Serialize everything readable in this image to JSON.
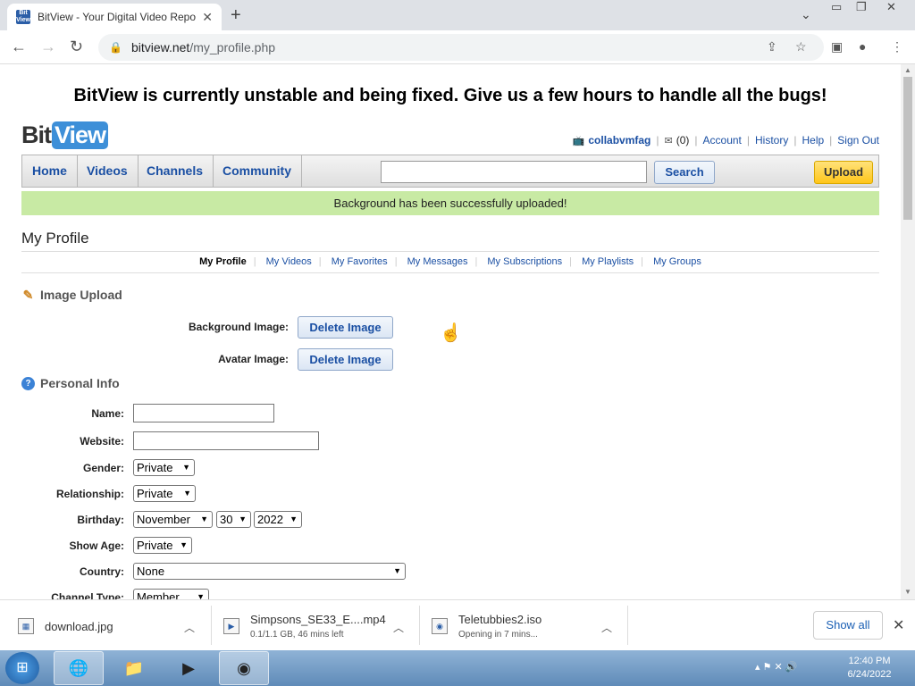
{
  "browser": {
    "tab_title": "BitView - Your Digital Video Repo",
    "favicon_text": "Bit View",
    "url_host": "bitview.net",
    "url_path": "/my_profile.php"
  },
  "site": {
    "banner": "BitView is currently unstable and being fixed. Give us a few hours to handle all the bugs!",
    "logo_bit": "Bit",
    "logo_view": "View",
    "user": {
      "username": "collabvmfag",
      "messages_count": "(0)",
      "links": [
        "Account",
        "History",
        "Help",
        "Sign Out"
      ]
    },
    "nav": [
      "Home",
      "Videos",
      "Channels",
      "Community"
    ],
    "search_button": "Search",
    "upload_button": "Upload",
    "notice": "Background has been successfully uploaded!"
  },
  "profile": {
    "title": "My Profile",
    "subnav": [
      "My Profile",
      "My Videos",
      "My Favorites",
      "My Messages",
      "My Subscriptions",
      "My Playlists",
      "My Groups"
    ],
    "image_upload": {
      "heading": "Image Upload",
      "background_label": "Background Image:",
      "avatar_label": "Avatar Image:",
      "delete_label": "Delete Image"
    },
    "personal_info": {
      "heading": "Personal Info",
      "name_label": "Name:",
      "website_label": "Website:",
      "gender_label": "Gender:",
      "gender_value": "Private",
      "relationship_label": "Relationship:",
      "relationship_value": "Private",
      "birthday_label": "Birthday:",
      "birthday_month": "November",
      "birthday_day": "30",
      "birthday_year": "2022",
      "show_age_label": "Show Age:",
      "show_age_value": "Private",
      "country_label": "Country:",
      "country_value": "None",
      "channel_type_label": "Channel Type:",
      "channel_type_value": "Member"
    }
  },
  "downloads": [
    {
      "name": "download.jpg",
      "status": ""
    },
    {
      "name": "Simpsons_SE33_E....mp4",
      "status": "0.1/1.1 GB, 46 mins left"
    },
    {
      "name": "Teletubbies2.iso",
      "status": "Opening in 7 mins..."
    }
  ],
  "show_all": "Show all",
  "clock": {
    "time": "12:40 PM",
    "date": "6/24/2022"
  }
}
